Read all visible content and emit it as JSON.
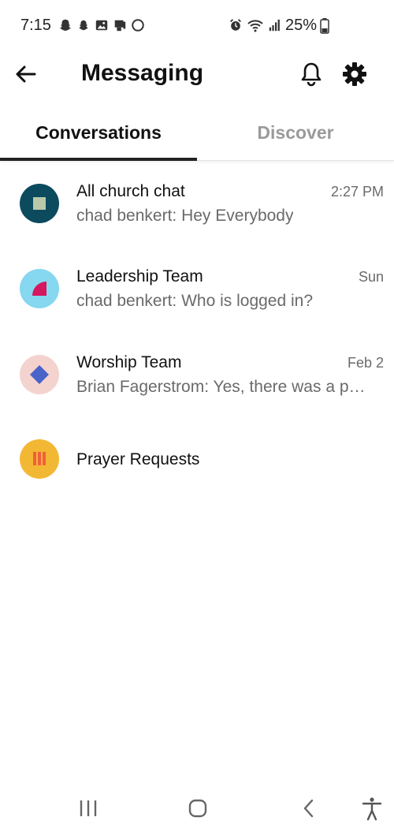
{
  "status_bar": {
    "time": "7:15",
    "battery": "25%",
    "left_icons": [
      "snapchat-icon",
      "snapchat-icon",
      "gallery-icon",
      "device-icon",
      "circle-icon"
    ],
    "right_icons": [
      "alarm-icon",
      "wifi-icon",
      "signal-icon",
      "battery-icon"
    ]
  },
  "header": {
    "title": "Messaging",
    "back_icon": "arrow-left-icon",
    "bell_icon": "bell-icon",
    "gear_icon": "gear-icon"
  },
  "tabs": [
    {
      "label": "Conversations",
      "active": true
    },
    {
      "label": "Discover",
      "active": false
    }
  ],
  "conversations": [
    {
      "name": "All church chat",
      "preview": "chad benkert: Hey Everybody",
      "time": "2:27 PM",
      "avatar_bg": "#0c4a5e",
      "avatar_fg": "#b9c8a8",
      "avatar_shape": "square"
    },
    {
      "name": "Leadership Team",
      "preview": "chad benkert: Who is logged in?",
      "time": "Sun",
      "avatar_bg": "#86d7f0",
      "avatar_fg": "#d4175e",
      "avatar_shape": "quarter-circle"
    },
    {
      "name": "Worship Team",
      "preview": "Brian Fagerstrom: Yes, there was a problem with this",
      "time": "Feb 2",
      "avatar_bg": "#f4d3cf",
      "avatar_fg": "#4a63c8",
      "avatar_shape": "diamond"
    },
    {
      "name": "Prayer Requests",
      "preview": "",
      "time": "",
      "avatar_bg": "#f3b833",
      "avatar_fg": "#f0603c",
      "avatar_shape": "bars"
    }
  ],
  "nav_bar": {
    "icons": [
      "recents-icon",
      "home-icon",
      "back-icon",
      "accessibility-icon"
    ]
  }
}
